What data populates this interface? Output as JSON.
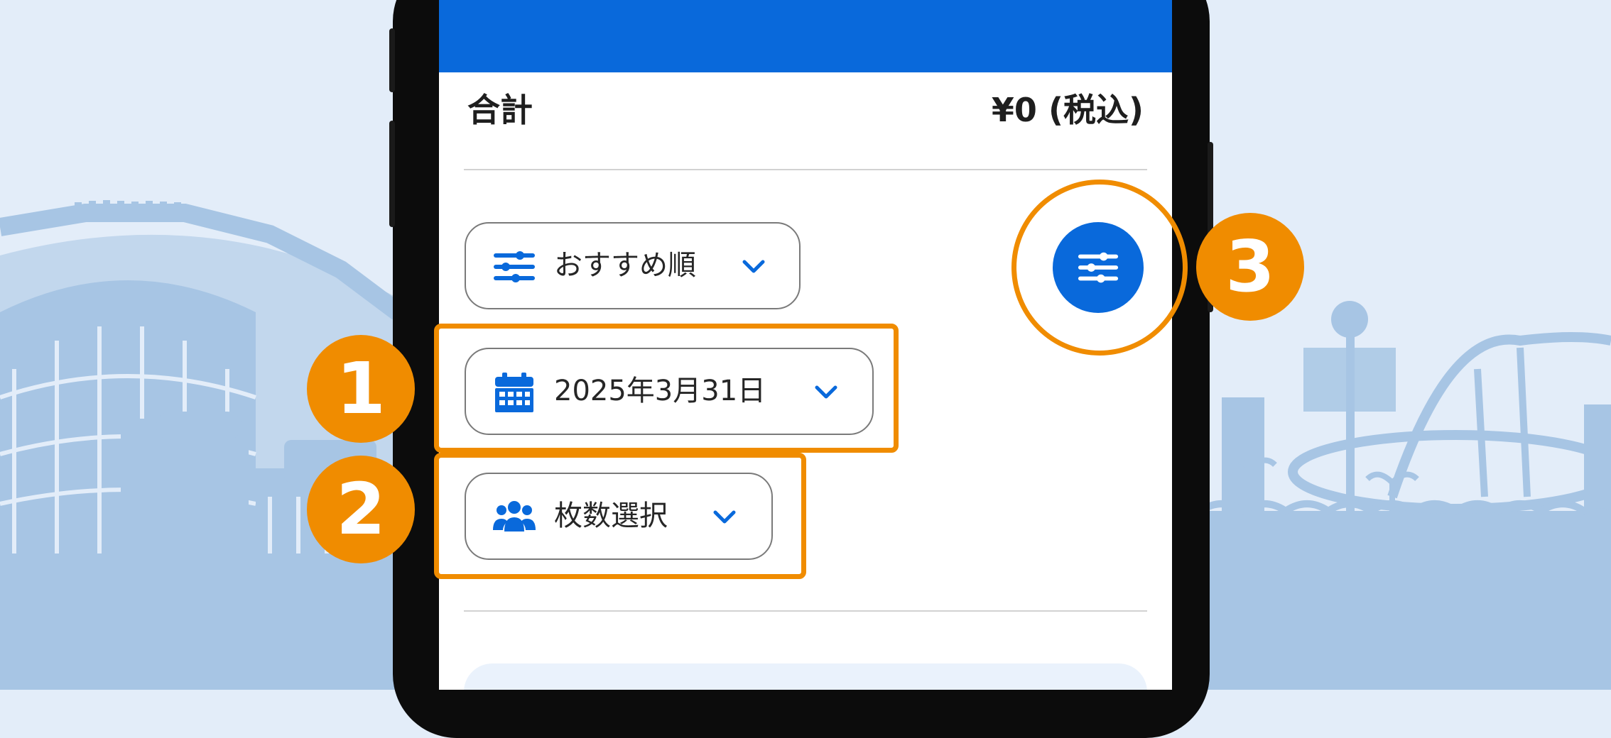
{
  "summary": {
    "total_label": "合計",
    "total_value": "¥0 (税込)"
  },
  "controls": {
    "sort": {
      "label": "おすすめ順",
      "icon": "sliders-icon"
    },
    "date": {
      "label": "2025年3月31日",
      "icon": "calendar-icon"
    },
    "tickets": {
      "label": "枚数選択",
      "icon": "people-group-icon"
    },
    "filter": {
      "icon": "sliders-icon"
    }
  },
  "callouts": [
    "1",
    "2",
    "3"
  ],
  "colors": {
    "brand_blue": "#0969db",
    "callout_orange": "#f08c00",
    "background": "#e3edf9",
    "skyline": "#a7c5e4"
  }
}
